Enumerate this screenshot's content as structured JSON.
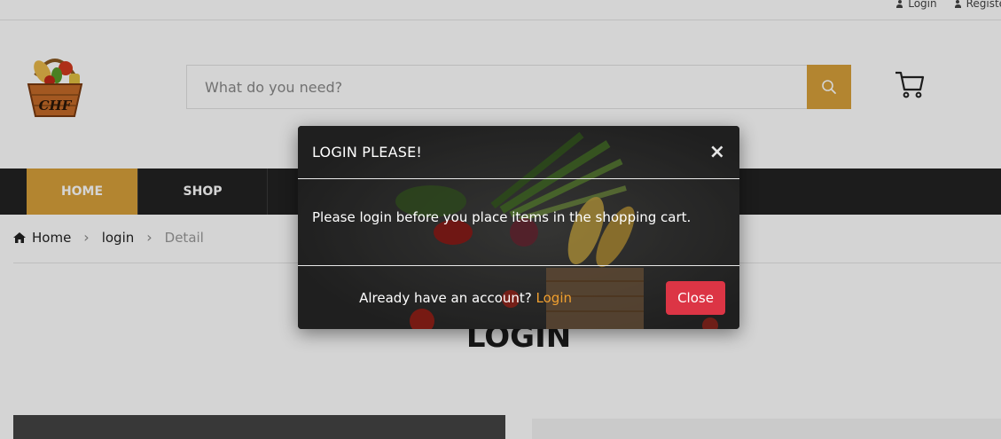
{
  "topbar": {
    "links": [
      {
        "label": "Login",
        "icon": "user-icon"
      },
      {
        "label": "Register",
        "icon": "user-icon"
      }
    ]
  },
  "header": {
    "logo_text": "CHF",
    "search": {
      "placeholder": "What do you need?",
      "value": "",
      "icon": "search-icon"
    },
    "cart_icon": "shopping-cart-icon"
  },
  "nav": {
    "items": [
      {
        "label": "HOME",
        "active": true
      },
      {
        "label": "SHOP",
        "active": false
      }
    ]
  },
  "breadcrumb": {
    "items": [
      "Home",
      "login",
      "Detail"
    ]
  },
  "page": {
    "title": "LOGIN"
  },
  "modal": {
    "title": "LOGIN PLEASE!",
    "close_symbol": "×",
    "message": "Please login before you place items in the shopping cart.",
    "footer_text": "Already have an account?",
    "footer_link": "Login",
    "close_button": "Close"
  },
  "colors": {
    "accent": "#d8a13a",
    "nav_bg": "#222222",
    "danger": "#dc3545",
    "link": "#f0a030"
  }
}
